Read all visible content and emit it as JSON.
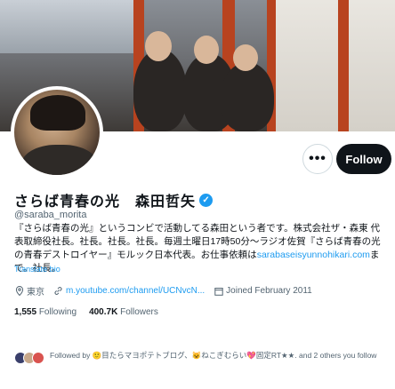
{
  "actions": {
    "more_label": "•••",
    "follow_label": "Follow"
  },
  "profile": {
    "name": "さらば青春の光　森田哲矢",
    "handle": "@saraba_morita",
    "bio_text": "『さらば青春の光』というコンビで活動してる森田という者です。株式会社ザ・森東 代表取締役社長。社長。社長。社長。毎週土曜日17時50分〜ラジオ佐賀『さらば青春の光の青春デストロイヤー』モルック日本代表。お仕事依頼は",
    "bio_link": "sarabaseisyunnohikari.com",
    "bio_tail": "まで。社長。",
    "translate": "Translate bio",
    "location": "東京",
    "url": "m.youtube.com/channel/UCNvcN...",
    "joined": "Joined February 2011"
  },
  "stats": {
    "following_count": "1,555",
    "following_label": "Following",
    "followers_count": "400.7K",
    "followers_label": "Followers"
  },
  "followed_by": {
    "text": "Followed by 🙂目たらマヨポテトブログ、😺ねこぎむらい💖固定RT★★. and 2 others you follow"
  },
  "colors": {
    "accent": "#1d9bf0",
    "text": "#0f1419",
    "secondary": "#536471",
    "button": "#0f1419"
  },
  "icons": {
    "location": "location-pin-icon",
    "link": "link-icon",
    "calendar": "calendar-icon",
    "verified": "verified-badge-icon"
  }
}
